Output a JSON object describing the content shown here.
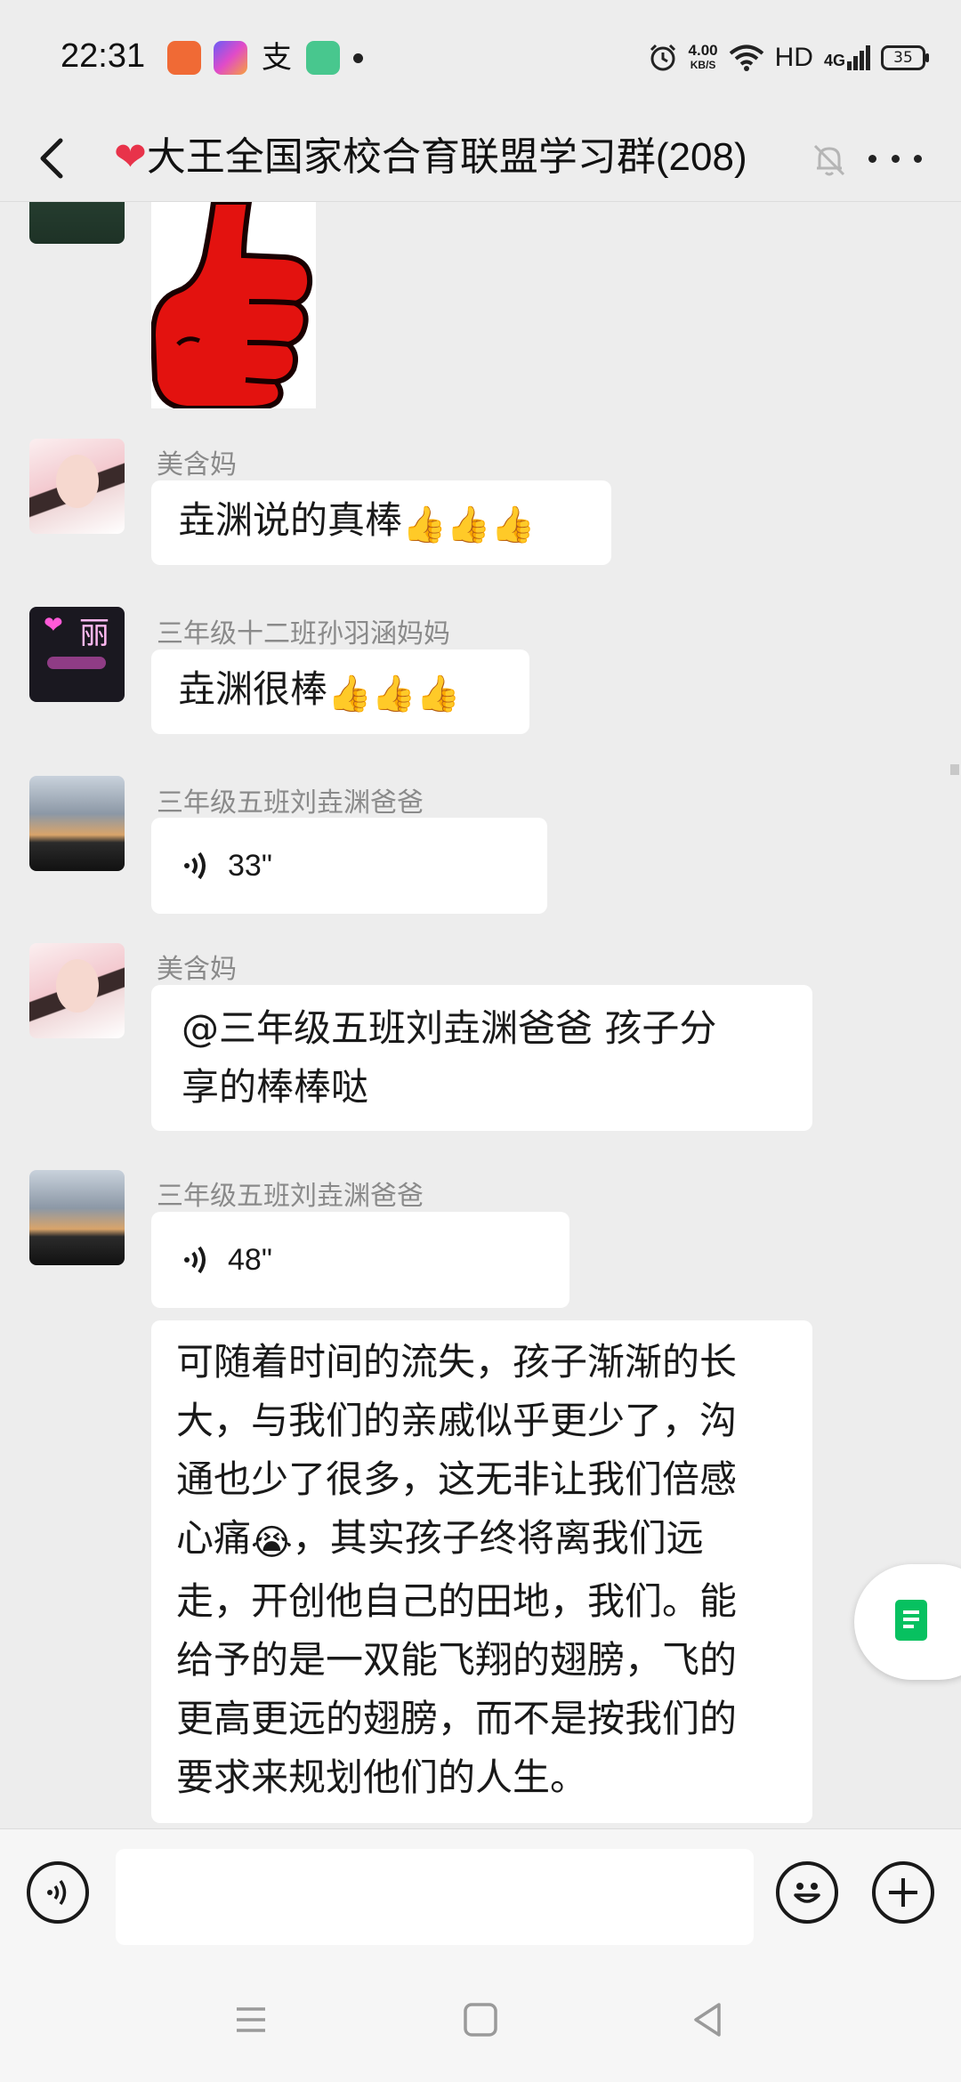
{
  "status": {
    "time": "22:31",
    "net_speed_value": "4.00",
    "net_speed_unit": "KB/S",
    "hd_label": "HD",
    "network_type": "4G",
    "battery": "35"
  },
  "header": {
    "title_emoji": "❤",
    "title": "大王全国家校合育联盟学习群(208)"
  },
  "messages": [
    {
      "sender": "",
      "type": "sticker",
      "description_icon": "thumbs-up-sticker"
    },
    {
      "sender": "美含妈",
      "type": "text",
      "text": "垚渊说的真棒",
      "emoji": "👍👍👍"
    },
    {
      "sender": "三年级十二班孙羽涵妈妈",
      "type": "text",
      "text": "垚渊很棒",
      "emoji": "👍👍👍"
    },
    {
      "sender": "三年级五班刘垚渊爸爸",
      "type": "voice",
      "duration": "33\""
    },
    {
      "sender": "美含妈",
      "type": "text",
      "text_line1": "@三年级五班刘垚渊爸爸 孩子分",
      "text_line2": "享的棒棒哒"
    },
    {
      "sender": "三年级五班刘垚渊爸爸",
      "type": "voice",
      "duration": "48\""
    },
    {
      "sender": "",
      "type": "text",
      "lines": [
        "可随着时间的流失，孩子渐渐的长",
        "大，与我们的亲戚似乎更少了，沟",
        "通也少了很多，这无非让我们倍感",
        "心痛",
        "，其实孩子终将离我们远",
        "走，开创他自己的田地，我们。能",
        "给予的是一双能飞翔的翅膀，飞的",
        "更高更远的翅膀，而不是按我们的",
        "要求来规划他们的人生。"
      ],
      "emoji_crying": "😭"
    }
  ],
  "avatar_neon_text": "丽",
  "colors": {
    "background": "#ededed",
    "bubble": "#ffffff",
    "accent_green": "#07c160",
    "sticker_red": "#e3120f"
  }
}
